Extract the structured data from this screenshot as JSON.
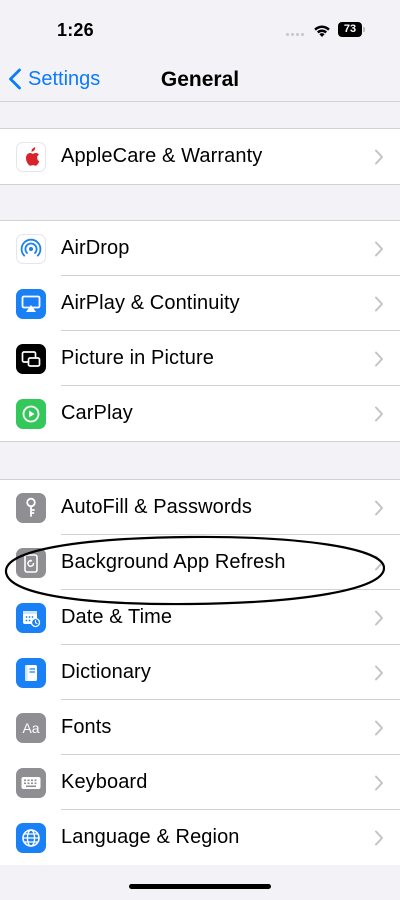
{
  "status": {
    "time": "1:26",
    "battery": "73"
  },
  "nav": {
    "back_label": "Settings",
    "title": "General"
  },
  "groups": [
    {
      "items": [
        {
          "label": "AppleCare & Warranty",
          "icon": "apple-icon"
        }
      ]
    },
    {
      "items": [
        {
          "label": "AirDrop",
          "icon": "airdrop-icon"
        },
        {
          "label": "AirPlay & Continuity",
          "icon": "airplay-icon"
        },
        {
          "label": "Picture in Picture",
          "icon": "picture-in-picture-icon"
        },
        {
          "label": "CarPlay",
          "icon": "carplay-icon"
        }
      ]
    },
    {
      "items": [
        {
          "label": "AutoFill & Passwords",
          "icon": "key-icon"
        },
        {
          "label": "Background App Refresh",
          "icon": "refresh-icon"
        },
        {
          "label": "Date & Time",
          "icon": "calendar-clock-icon"
        },
        {
          "label": "Dictionary",
          "icon": "book-icon"
        },
        {
          "label": "Fonts",
          "icon": "fonts-icon"
        },
        {
          "label": "Keyboard",
          "icon": "keyboard-icon"
        },
        {
          "label": "Language & Region",
          "icon": "globe-icon"
        }
      ]
    }
  ],
  "colors": {
    "accent": "#0a7aff",
    "background": "#f2f2f7",
    "airplay": "#1a80f5",
    "carplay": "#34c759",
    "gray_icon": "#8e8e93",
    "date_time": "#1a80f5",
    "dictionary": "#1a80f5",
    "language": "#1a80f5"
  }
}
